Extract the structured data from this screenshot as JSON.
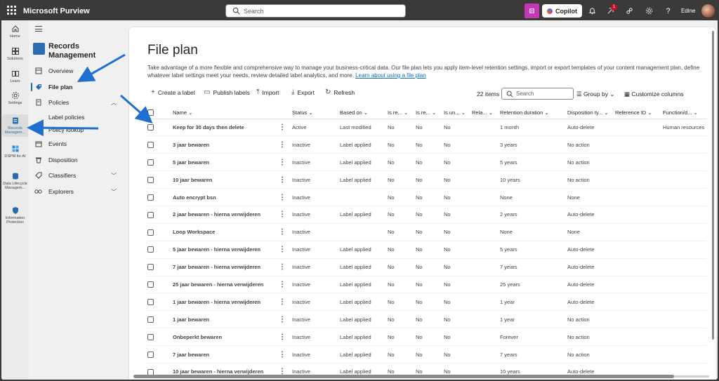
{
  "app": {
    "brand": "Microsoft Purview",
    "search_placeholder": "Search",
    "copilot_label": "Copilot",
    "notification_count": "1",
    "user_name": "Edine"
  },
  "rail": [
    {
      "label": "Home",
      "icon": "home-icon"
    },
    {
      "label": "Solutions",
      "icon": "solutions-icon"
    },
    {
      "label": "Learn",
      "icon": "learn-icon"
    },
    {
      "label": "Settings",
      "icon": "settings-icon"
    },
    {
      "label": "Records Managem...",
      "icon": "records-icon"
    },
    {
      "label": "DSPM for AI",
      "icon": "dspm-icon"
    },
    {
      "label": "Data Lifecycle Managem...",
      "icon": "data-lifecycle-icon"
    },
    {
      "label": "Information Protection",
      "icon": "information-protection-icon"
    }
  ],
  "nav": {
    "title": "Records Management",
    "items": [
      {
        "label": "Overview",
        "icon": "overview-icon"
      },
      {
        "label": "File plan",
        "icon": "file-plan-icon"
      },
      {
        "label": "Policies",
        "icon": "policies-icon"
      },
      {
        "label": "Label policies",
        "icon": ""
      },
      {
        "label": "Policy lookup",
        "icon": ""
      },
      {
        "label": "Events",
        "icon": "events-icon"
      },
      {
        "label": "Disposition",
        "icon": "disposition-icon"
      },
      {
        "label": "Classifiers",
        "icon": "classifiers-icon"
      },
      {
        "label": "Explorers",
        "icon": "explorers-icon"
      }
    ]
  },
  "page": {
    "title": "File plan",
    "description": "Take advantage of a more flexible and comprehensive way to manage your business-critical data. Our file plan lets you apply item-level retention settings, import or export templates of your content management plan, define whatever label settings meet your needs, review detailed label analytics, and more.",
    "learn_link": "Learn about using a file plan",
    "commands": {
      "create": "Create a label",
      "publish": "Publish labels",
      "import": "Import",
      "export": "Export",
      "refresh": "Refresh"
    },
    "item_count": "22 items",
    "filter_placeholder": "Search",
    "group_by": "Group by",
    "customize": "Customize columns"
  },
  "table": {
    "columns": [
      "Name",
      "Status",
      "Based on",
      "Is re...",
      "Is re...",
      "Is un...",
      "Rela...",
      "Retention duration",
      "Disposition ty...",
      "Reference ID",
      "Function/d..."
    ],
    "rows": [
      [
        "Keep for 30 days then delete",
        "Active",
        "Last modified",
        "No",
        "No",
        "No",
        "",
        "1 month",
        "Auto-delete",
        "",
        "Human resources"
      ],
      [
        "3 jaar bewaren",
        "Inactive",
        "Label applied",
        "No",
        "No",
        "No",
        "",
        "3 years",
        "No action",
        "",
        ""
      ],
      [
        "5 jaar bewaren",
        "Inactive",
        "Label applied",
        "No",
        "No",
        "No",
        "",
        "5 years",
        "No action",
        "",
        ""
      ],
      [
        "10 jaar bewaren",
        "Inactive",
        "Label applied",
        "No",
        "No",
        "No",
        "",
        "10 years",
        "No action",
        "",
        ""
      ],
      [
        "Auto encrypt bsn",
        "Inactive",
        "",
        "No",
        "No",
        "No",
        "",
        "None",
        "None",
        "",
        ""
      ],
      [
        "2 jaar bewaren - hierna verwijderen",
        "Inactive",
        "Label applied",
        "No",
        "No",
        "No",
        "",
        "2 years",
        "Auto-delete",
        "",
        ""
      ],
      [
        "Loop Workspace",
        "Inactive",
        "",
        "No",
        "No",
        "No",
        "",
        "None",
        "None",
        "",
        ""
      ],
      [
        "5 jaar bewaren - hierna verwijderen",
        "Inactive",
        "Label applied",
        "No",
        "No",
        "No",
        "",
        "5 years",
        "Auto-delete",
        "",
        ""
      ],
      [
        "7 jaar bewaren - hierna verwijderen",
        "Inactive",
        "Label applied",
        "No",
        "No",
        "No",
        "",
        "7 years",
        "Auto-delete",
        "",
        ""
      ],
      [
        "25 jaar bewaren - hierna verwijderen",
        "Inactive",
        "Label applied",
        "No",
        "No",
        "No",
        "",
        "25 years",
        "Auto-delete",
        "",
        ""
      ],
      [
        "1 jaar bewaren - hierna verwijderen",
        "Inactive",
        "Label applied",
        "No",
        "No",
        "No",
        "",
        "1 year",
        "Auto-delete",
        "",
        ""
      ],
      [
        "1 jaar bewaren",
        "Inactive",
        "Label applied",
        "No",
        "No",
        "No",
        "",
        "1 year",
        "No action",
        "",
        ""
      ],
      [
        "Onbeperkt bewaren",
        "Inactive",
        "Label applied",
        "No",
        "No",
        "No",
        "",
        "Forever",
        "No action",
        "",
        ""
      ],
      [
        "7 jaar bewaren",
        "Inactive",
        "Label applied",
        "No",
        "No",
        "No",
        "",
        "7 years",
        "No action",
        "",
        ""
      ],
      [
        "10 jaar bewaren - hierna verwijderen",
        "Inactive",
        "Label applied",
        "No",
        "No",
        "No",
        "",
        "10 years",
        "Auto-delete",
        "",
        ""
      ]
    ]
  },
  "colors": {
    "accent": "#0f6cbd",
    "arrow": "#1f6fd1",
    "topbar": "#3b3a39",
    "copilot": "#c239b3"
  }
}
